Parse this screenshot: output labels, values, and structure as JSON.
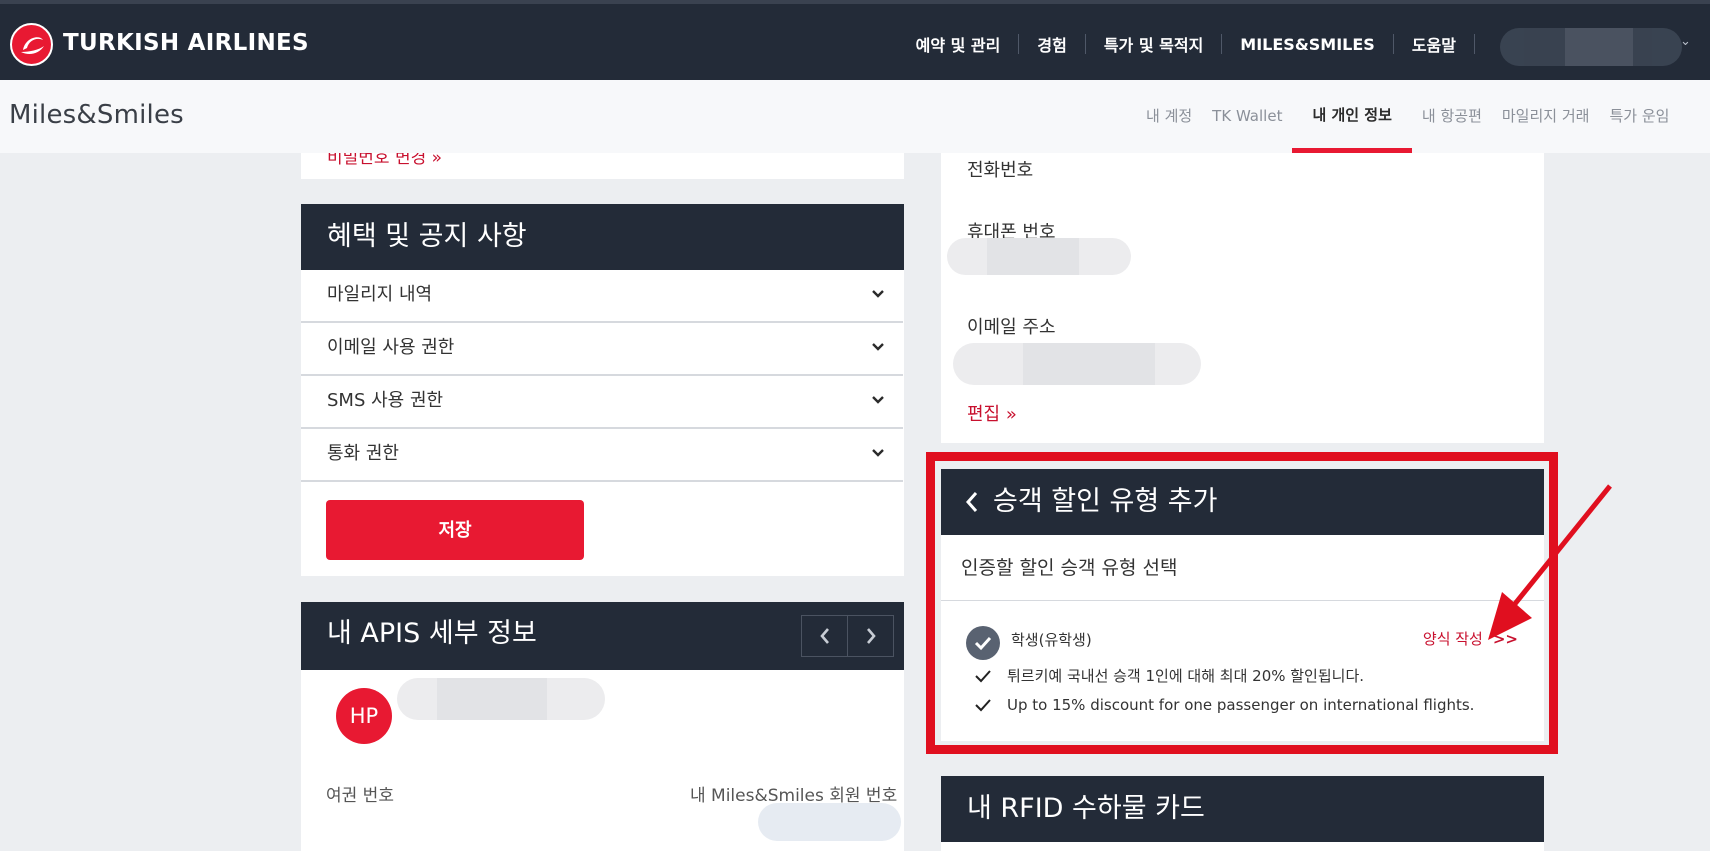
{
  "header": {
    "brand": "TURKISH AIRLINES",
    "nav": [
      "예약 및 관리",
      "경험",
      "특가 및 목적지",
      "MILES&SMILES",
      "도움말"
    ]
  },
  "subnav": {
    "logo_text": "Miles&Smiles",
    "tabs": [
      {
        "label": "내 계정",
        "active": false
      },
      {
        "label": "TK Wallet",
        "active": false
      },
      {
        "label": "내 개인 정보",
        "active": true
      },
      {
        "label": "내 항공편",
        "active": false
      },
      {
        "label": "마일리지 거래",
        "active": false
      },
      {
        "label": "특가 운임",
        "active": false
      }
    ]
  },
  "left": {
    "top_partial_link": "비밀번호 변경 »",
    "benefits": {
      "title": "혜택 및 공지 사항",
      "rows": [
        "마일리지 내역",
        "이메일 사용 권한",
        "SMS 사용 권한",
        "통화 권한"
      ],
      "save_label": "저장"
    },
    "apis": {
      "title": "내 APIS 세부 정보",
      "initials": "HP",
      "passport_label": "여권 번호",
      "member_label": "내 Miles&Smiles 회원 번호"
    }
  },
  "right": {
    "phone_label": "전화번호",
    "mobile_label": "휴대폰 번호",
    "email_label": "이메일 주소",
    "edit_label": "편집 »",
    "discount": {
      "title": "승객 할인 유형 추가",
      "subtitle": "인증할 할인 승객 유형 선택",
      "option_label": "학생(유학생)",
      "form_link": "양식 작성",
      "form_link_suffix": ">>",
      "perks": [
        "튀르키예 국내선 승객 1인에 대해 최대 20% 할인됩니다.",
        "Up to 15% discount for one passenger on international flights."
      ]
    },
    "rfid_title": "내 RFID 수하물 카드"
  },
  "colors": {
    "navy": "#232b38",
    "brand_red": "#e81932",
    "annotation_red": "#e00f1f"
  }
}
